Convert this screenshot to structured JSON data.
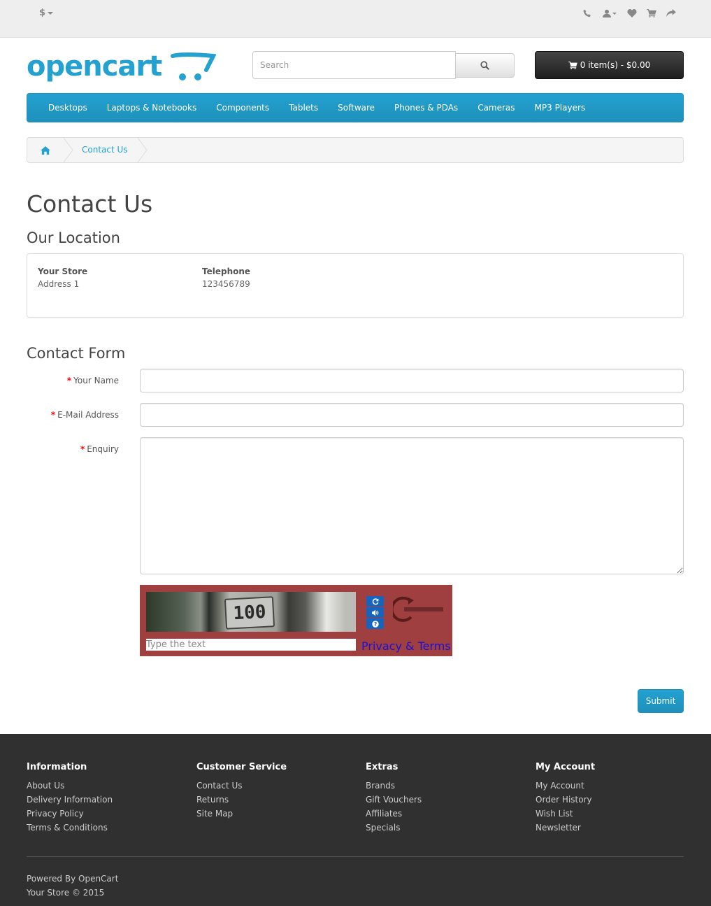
{
  "top": {
    "currency": "$"
  },
  "logo": {
    "text": "opencart"
  },
  "search": {
    "placeholder": "Search"
  },
  "cart": {
    "label": "0 item(s) - $0.00"
  },
  "menu": [
    "Desktops",
    "Laptops & Notebooks",
    "Components",
    "Tablets",
    "Software",
    "Phones & PDAs",
    "Cameras",
    "MP3 Players"
  ],
  "breadcrumb": {
    "current": "Contact Us"
  },
  "page_title": "Contact Us",
  "location": {
    "heading": "Our Location",
    "store_name": "Your Store",
    "address": "Address 1",
    "telephone_label": "Telephone",
    "telephone": "123456789"
  },
  "form": {
    "heading": "Contact Form",
    "name_label": "Your Name",
    "email_label": "E-Mail Address",
    "enquiry_label": "Enquiry",
    "required_mark": "*",
    "submit_label": "Submit"
  },
  "captcha": {
    "code": "100",
    "placeholder": "Type the text",
    "privacy": "Privacy & Terms"
  },
  "footer": {
    "columns": [
      {
        "title": "Information",
        "links": [
          "About Us",
          "Delivery Information",
          "Privacy Policy",
          "Terms & Conditions"
        ]
      },
      {
        "title": "Customer Service",
        "links": [
          "Contact Us",
          "Returns",
          "Site Map"
        ]
      },
      {
        "title": "Extras",
        "links": [
          "Brands",
          "Gift Vouchers",
          "Affiliates",
          "Specials"
        ]
      },
      {
        "title": "My Account",
        "links": [
          "My Account",
          "Order History",
          "Wish List",
          "Newsletter"
        ]
      }
    ],
    "powered_prefix": "Powered By",
    "powered_link": "OpenCart",
    "copyright": "Your Store © 2015"
  },
  "colors": {
    "accent": "#23a1d1",
    "footer_bg": "#303030",
    "captcha_bg": "#9f3f3f"
  }
}
